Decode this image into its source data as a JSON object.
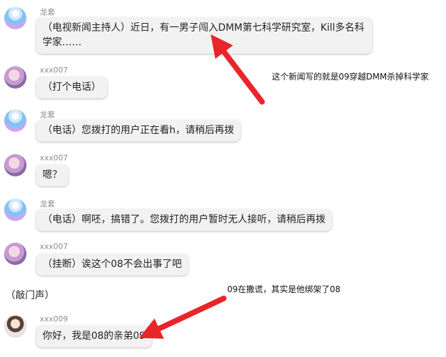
{
  "messages": [
    {
      "sender": "龙套",
      "avatar": "long-avatar",
      "text": "（电视新闻主持人）近日，有一男子闯入DMM第七科学研究室，Kill多名科学家……"
    },
    {
      "sender": "xxx007",
      "avatar": "xxx007-avatar",
      "text": "（打个电话）"
    },
    {
      "sender": "龙套",
      "avatar": "long-avatar",
      "text": "（电话）您拨打的用户正在看h，请稍后再拨"
    },
    {
      "sender": "xxx007",
      "avatar": "xxx007-avatar",
      "text": "嗯？"
    },
    {
      "sender": "龙套",
      "avatar": "long-avatar",
      "text": "（电话）啊呸，搞错了。您拨打的用户暂时无人接听，请稍后再拨"
    },
    {
      "sender": "xxx007",
      "avatar": "xxx007-avatar",
      "text": "（挂断）诶这个08不会出事了吧"
    },
    {
      "sender": "xxx009",
      "avatar": "xxx009-avatar",
      "text": "你好，我是08的亲弟09"
    }
  ],
  "narration": "（敲门声）",
  "annotations": {
    "note1": "这个新闻写的就是09穿越DMM杀掉科学家",
    "note2": "09在撒谎，其实是他绑架了08"
  },
  "colors": {
    "arrow": "#e8252a",
    "bubble": "#f2f2f2",
    "sender_name": "#8c8c8c"
  }
}
